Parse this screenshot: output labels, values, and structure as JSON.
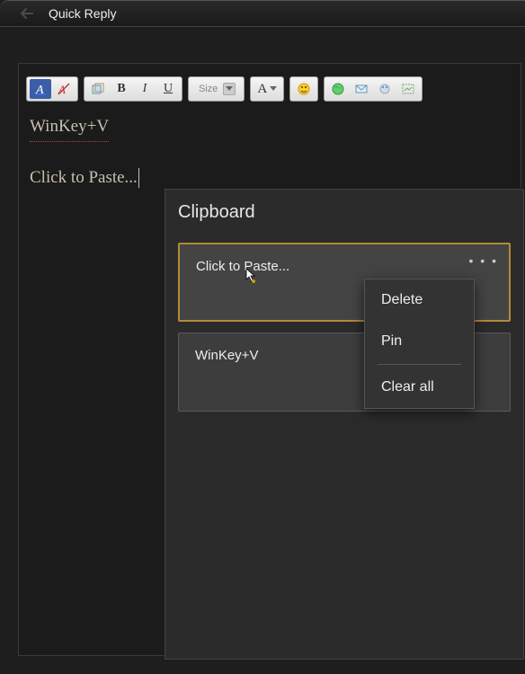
{
  "window": {
    "title": "Quick Reply"
  },
  "toolbar": {
    "size_label": "Size"
  },
  "compose": {
    "line1": "WinKey+V",
    "line2": "Click to Paste..."
  },
  "clipboard": {
    "title": "Clipboard",
    "items": [
      {
        "text": "Click to Paste...",
        "selected": true
      },
      {
        "text": "WinKey+V",
        "selected": false
      }
    ],
    "more_glyph": "• • •"
  },
  "context_menu": {
    "delete": "Delete",
    "pin": "Pin",
    "clear_all": "Clear all"
  }
}
